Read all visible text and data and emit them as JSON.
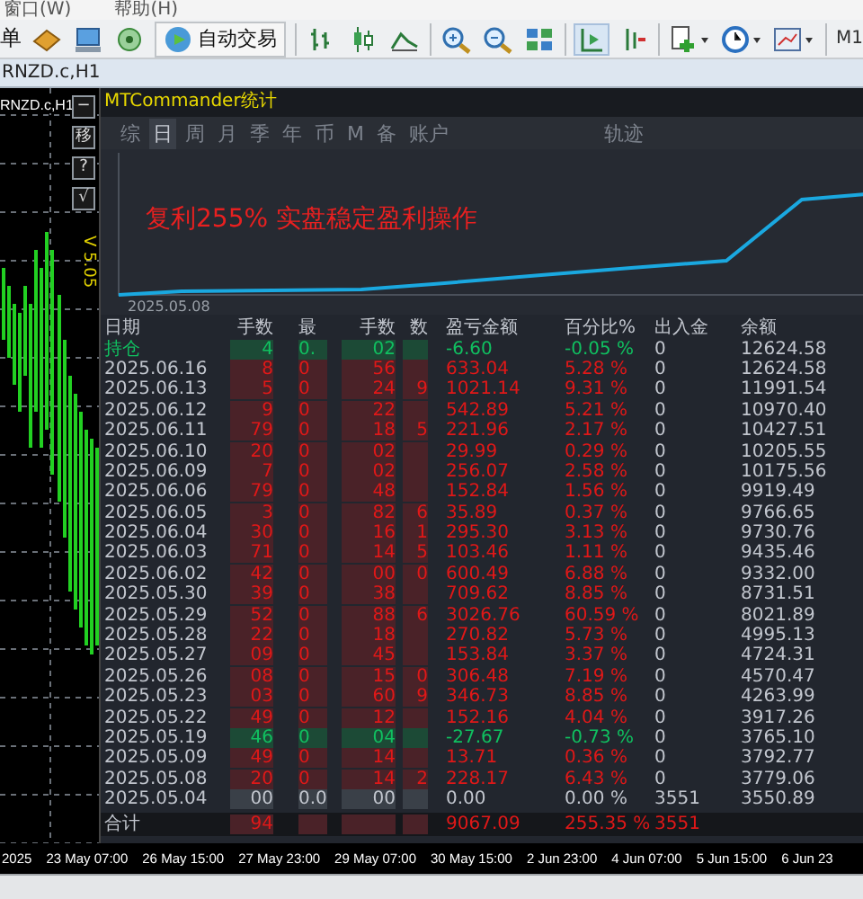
{
  "menu": [
    "窗口(W)",
    "帮助(H)"
  ],
  "toolbar": {
    "cut_label": "单",
    "autotrade": "自动交易",
    "period": "M1"
  },
  "chart_tab": "RNZD.c,H1",
  "chart": {
    "symbol": "RNZD.c,H1",
    "side_buttons": [
      "−",
      "移",
      "?",
      "√"
    ],
    "version": "V 5.05"
  },
  "panel": {
    "title": "MTCommander统计",
    "tabs": [
      {
        "label": "综",
        "selected": false
      },
      {
        "label": "日",
        "selected": true
      },
      {
        "label": "周",
        "selected": false
      },
      {
        "label": "月",
        "selected": false
      },
      {
        "label": "季",
        "selected": false
      },
      {
        "label": "年",
        "selected": false
      },
      {
        "label": "币",
        "selected": false
      },
      {
        "label": "M",
        "selected": false
      },
      {
        "label": "备",
        "selected": false
      },
      {
        "label": "账户",
        "selected": false
      }
    ],
    "trail_tab": {
      "label": "轨迹",
      "selected": false
    },
    "curve": {
      "overlay_text": "复利255%  实盘稳定盈利操作",
      "start_date": "2025.05.08"
    },
    "table": {
      "columns": [
        "日期",
        "手数",
        "最",
        "手数",
        "数",
        "盈亏金额",
        "百分比%",
        "出入金",
        "余额"
      ],
      "rows": [
        {
          "kind": "position",
          "color": "#10c060",
          "cells": [
            "持仓",
            "4",
            "0.",
            "02",
            "",
            "-6.60",
            "-0.05 %",
            "0",
            "12624.58"
          ]
        },
        {
          "kind": "day",
          "color": "#e01818",
          "cells": [
            "2025.06.16",
            "8",
            "0",
            "56",
            "",
            "633.04",
            "5.28 %",
            "0",
            "12624.58"
          ]
        },
        {
          "kind": "day",
          "color": "#e01818",
          "cells": [
            "2025.06.13",
            "5",
            "0",
            "24",
            "9",
            "1021.14",
            "9.31 %",
            "0",
            "11991.54"
          ]
        },
        {
          "kind": "day",
          "color": "#e01818",
          "cells": [
            "2025.06.12",
            "9",
            "0",
            "22",
            "",
            "542.89",
            "5.21 %",
            "0",
            "10970.40"
          ]
        },
        {
          "kind": "day",
          "color": "#e01818",
          "cells": [
            "2025.06.11",
            "79",
            "0",
            "18",
            "5",
            "221.96",
            "2.17 %",
            "0",
            "10427.51"
          ]
        },
        {
          "kind": "day",
          "color": "#e01818",
          "cells": [
            "2025.06.10",
            "20",
            "0",
            "02",
            "",
            "29.99",
            "0.29 %",
            "0",
            "10205.55"
          ]
        },
        {
          "kind": "day",
          "color": "#e01818",
          "cells": [
            "2025.06.09",
            "7",
            "0",
            "02",
            "",
            "256.07",
            "2.58 %",
            "0",
            "10175.56"
          ]
        },
        {
          "kind": "day",
          "color": "#e01818",
          "cells": [
            "2025.06.06",
            "79",
            "0",
            "48",
            "",
            "152.84",
            "1.56 %",
            "0",
            "9919.49"
          ]
        },
        {
          "kind": "day",
          "color": "#e01818",
          "cells": [
            "2025.06.05",
            "3",
            "0",
            "82",
            "6",
            "35.89",
            "0.37 %",
            "0",
            "9766.65"
          ]
        },
        {
          "kind": "day",
          "color": "#e01818",
          "cells": [
            "2025.06.04",
            "30",
            "0",
            "16",
            "1",
            "295.30",
            "3.13 %",
            "0",
            "9730.76"
          ]
        },
        {
          "kind": "day",
          "color": "#e01818",
          "cells": [
            "2025.06.03",
            "71",
            "0",
            "14",
            "5",
            "103.46",
            "1.11 %",
            "0",
            "9435.46"
          ]
        },
        {
          "kind": "day",
          "color": "#e01818",
          "cells": [
            "2025.06.02",
            "42",
            "0",
            "00",
            "0",
            "600.49",
            "6.88 %",
            "0",
            "9332.00"
          ]
        },
        {
          "kind": "day",
          "color": "#e01818",
          "cells": [
            "2025.05.30",
            "39",
            "0",
            "38",
            "",
            "709.62",
            "8.85 %",
            "0",
            "8731.51"
          ]
        },
        {
          "kind": "day",
          "color": "#e01818",
          "cells": [
            "2025.05.29",
            "52",
            "0",
            "88",
            "6",
            "3026.76",
            "60.59 %",
            "0",
            "8021.89"
          ]
        },
        {
          "kind": "day",
          "color": "#e01818",
          "cells": [
            "2025.05.28",
            "22",
            "0",
            "18",
            "",
            "270.82",
            "5.73 %",
            "0",
            "4995.13"
          ]
        },
        {
          "kind": "day",
          "color": "#e01818",
          "cells": [
            "2025.05.27",
            "09",
            "0",
            "45",
            "",
            "153.84",
            "3.37 %",
            "0",
            "4724.31"
          ]
        },
        {
          "kind": "day",
          "color": "#e01818",
          "cells": [
            "2025.05.26",
            "08",
            "0",
            "15",
            "0",
            "306.48",
            "7.19 %",
            "0",
            "4570.47"
          ]
        },
        {
          "kind": "day",
          "color": "#e01818",
          "cells": [
            "2025.05.23",
            "03",
            "0",
            "60",
            "9",
            "346.73",
            "8.85 %",
            "0",
            "4263.99"
          ]
        },
        {
          "kind": "day",
          "color": "#e01818",
          "cells": [
            "2025.05.22",
            "49",
            "0",
            "12",
            "",
            "152.16",
            "4.04 %",
            "0",
            "3917.26"
          ]
        },
        {
          "kind": "day",
          "color": "#10c060",
          "cells": [
            "2025.05.19",
            "46",
            "0",
            "04",
            "",
            "-27.67",
            "-0.73 %",
            "0",
            "3765.10"
          ]
        },
        {
          "kind": "day",
          "color": "#e01818",
          "cells": [
            "2025.05.09",
            "49",
            "0",
            "14",
            "",
            "13.71",
            "0.36 %",
            "0",
            "3792.77"
          ]
        },
        {
          "kind": "day",
          "color": "#e01818",
          "cells": [
            "2025.05.08",
            "20",
            "0",
            "14",
            "2",
            "228.17",
            "6.43 %",
            "0",
            "3779.06"
          ]
        },
        {
          "kind": "day",
          "color": "#c2c6ce",
          "cells": [
            "2025.05.04",
            "00",
            "0.0",
            "00",
            "",
            "0.00",
            "0.00 %",
            "3551",
            "3550.89"
          ]
        },
        {
          "kind": "total",
          "color": "#e01818",
          "cells": [
            "合计",
            "94",
            "",
            "",
            "",
            "9067.09",
            "255.35 %",
            "3551",
            ""
          ]
        }
      ]
    }
  },
  "time_axis": [
    "2025",
    "23 May 07:00",
    "26 May 15:00",
    "27 May 23:00",
    "29 May 07:00",
    "30 May 15:00",
    "2 Jun 23:00",
    "4 Jun 07:00",
    "5 Jun 15:00",
    "6 Jun 23"
  ]
}
